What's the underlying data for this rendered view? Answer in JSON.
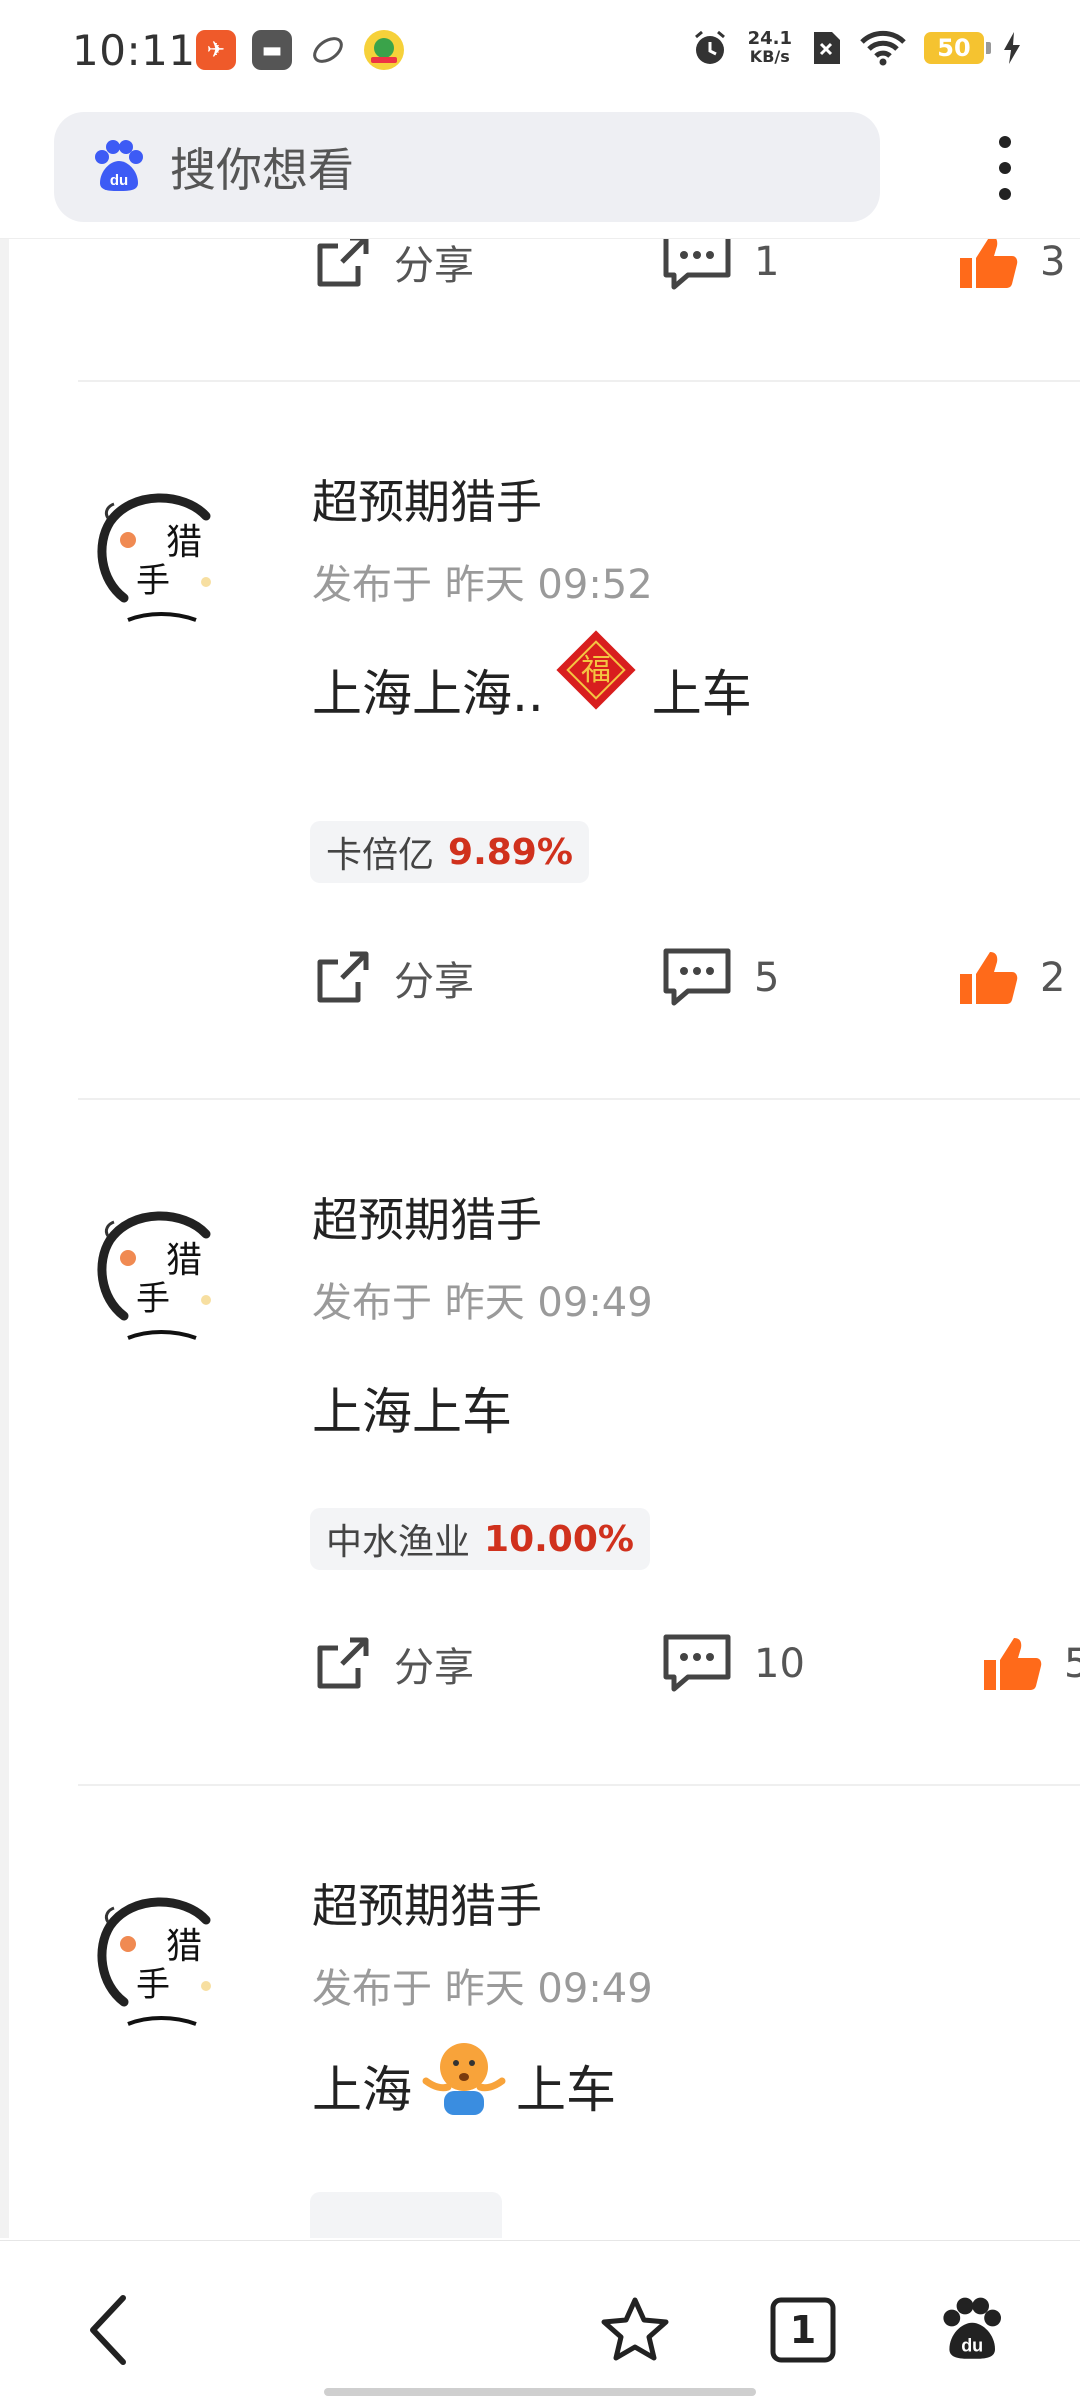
{
  "status_bar": {
    "time": "10:11",
    "net_speed_value": "24.1",
    "net_speed_unit": "KB/s",
    "battery": "50"
  },
  "search": {
    "placeholder": "搜你想看"
  },
  "colors": {
    "accent_red": "#d0311d",
    "like_orange": "#ff6a1a",
    "baidu_blue": "#3d5bf5"
  },
  "top_partial": {
    "share_label": "分享",
    "comments": "1",
    "likes": "3"
  },
  "posts": [
    {
      "author": "超预期猎手",
      "time": "发布于 昨天 09:52",
      "content_parts": [
        "上海上海..",
        "上车"
      ],
      "emoji": "fu-sticker",
      "stock_name": "卡倍亿",
      "stock_change": "9.89%",
      "share_label": "分享",
      "comments": "5",
      "likes": "2"
    },
    {
      "author": "超预期猎手",
      "time": "发布于 昨天 09:49",
      "content_parts": [
        "上海上车"
      ],
      "stock_name": "中水渔业",
      "stock_change": "10.00%",
      "share_label": "分享",
      "comments": "10",
      "likes": "5"
    },
    {
      "author": "超预期猎手",
      "time": "发布于 昨天 09:49",
      "content_parts": [
        "上海",
        "上车"
      ],
      "emoji": "shrug-emoji"
    }
  ],
  "bottom_nav": {
    "tab_count": "1"
  }
}
